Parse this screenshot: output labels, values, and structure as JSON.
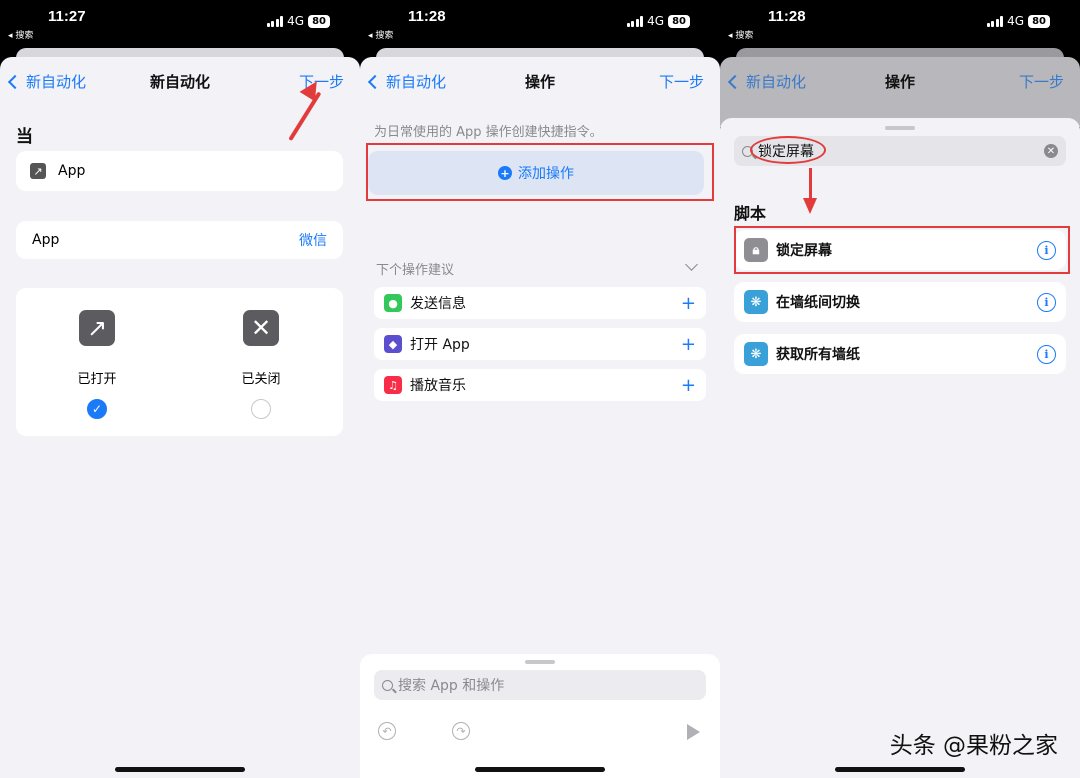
{
  "phone1": {
    "status": {
      "time": "11:27",
      "back": "◂ 搜索",
      "network": "4G",
      "battery": "80"
    },
    "nav": {
      "back": "新自动化",
      "title": "新自动化",
      "next": "下一步"
    },
    "section_when": "当",
    "trigger_label": "App",
    "app_row": {
      "label": "App",
      "value": "微信"
    },
    "options": [
      {
        "label": "已打开",
        "checked": true
      },
      {
        "label": "已关闭",
        "checked": false
      }
    ]
  },
  "phone2": {
    "status": {
      "time": "11:28",
      "back": "◂ 搜索",
      "network": "4G",
      "battery": "80"
    },
    "nav": {
      "back": "新自动化",
      "title": "操作",
      "next": "下一步"
    },
    "hint": "为日常使用的 App 操作创建快捷指令。",
    "add_action": "添加操作",
    "suggestions_header": "下个操作建议",
    "suggestions": [
      {
        "label": "发送信息",
        "color": "#34c759"
      },
      {
        "label": "打开 App",
        "color": "#5b4fcf"
      },
      {
        "label": "播放音乐",
        "color": "#fa2d48"
      }
    ],
    "search_placeholder": "搜索 App 和操作"
  },
  "phone3": {
    "status": {
      "time": "11:28",
      "back": "◂ 搜索",
      "network": "4G",
      "battery": "80"
    },
    "nav": {
      "back": "新自动化",
      "title": "操作",
      "next": "下一步"
    },
    "search_value": "锁定屏幕",
    "section": "脚本",
    "results": [
      {
        "label": "锁定屏幕",
        "color": "#8e8e93"
      },
      {
        "label": "在墙纸间切换",
        "color": "#3aa0d8"
      },
      {
        "label": "获取所有墙纸",
        "color": "#3aa0d8"
      }
    ]
  },
  "watermark": "头条 @果粉之家"
}
